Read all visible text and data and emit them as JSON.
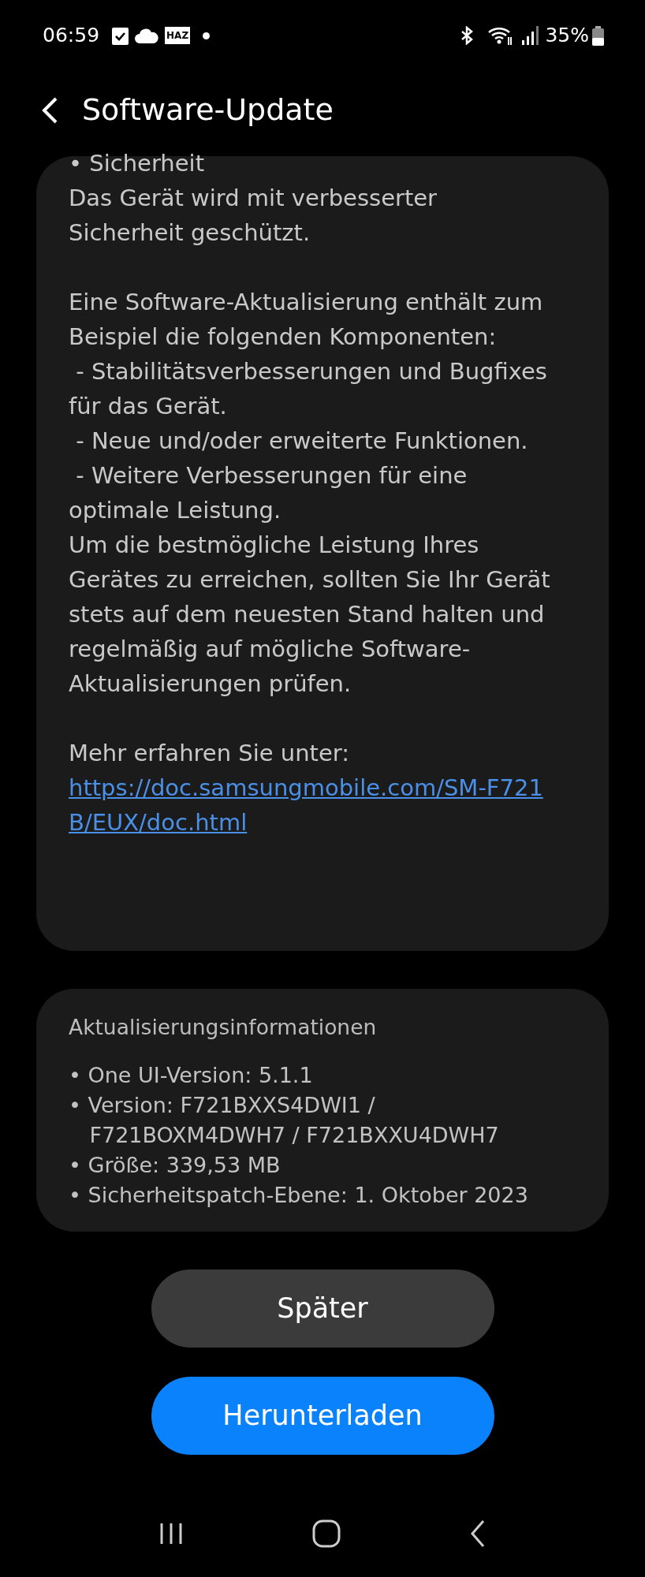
{
  "status_bar": {
    "time": "06:59",
    "notification_badge": "HAZ",
    "battery": "35%"
  },
  "header": {
    "title": "Software-Update"
  },
  "notes_card": {
    "sections": [
      {
        "items": [
          {
            "kind": "text",
            "text": "• Sicherheit"
          },
          {
            "kind": "text",
            "text": "Das Gerät wird mit verbesserter Sicherheit geschützt."
          }
        ]
      },
      {
        "items": [
          {
            "kind": "text",
            "text": "Eine Software-Aktualisierung enthält zum Beispiel die folgenden Komponenten:"
          },
          {
            "kind": "text",
            "text": " - Stabilitätsverbesserungen und Bugfixes für das Gerät."
          },
          {
            "kind": "text",
            "text": " - Neue und/oder erweiterte Funktionen."
          },
          {
            "kind": "text",
            "text": " - Weitere Verbesserungen für eine optimale Leistung."
          },
          {
            "kind": "text",
            "text": "Um die bestmögliche Leistung Ihres Gerätes zu erreichen, sollten Sie Ihr Gerät stets auf dem neuesten Stand halten und regelmäßig auf mögliche Software-Aktualisierungen prüfen."
          }
        ]
      },
      {
        "items": [
          {
            "kind": "text",
            "text": "Mehr erfahren Sie unter:"
          },
          {
            "kind": "link",
            "text": "https://doc.samsungmobile.com/SM-F721B/EUX/doc.html"
          }
        ]
      }
    ]
  },
  "info_card": {
    "title": "Aktualisierungsinformationen",
    "items": [
      "• One UI-Version: 5.1.1",
      "• Version: F721BXXS4DWI1 / F721BOXM4DWH7 / F721BXXU4DWH7",
      "• Größe: 339,53 MB",
      "• Sicherheitspatch-Ebene: 1. Oktober 2023"
    ]
  },
  "buttons": [
    {
      "label": "Später",
      "kind": "secondary"
    },
    {
      "label": "Herunterladen",
      "kind": "primary"
    }
  ]
}
